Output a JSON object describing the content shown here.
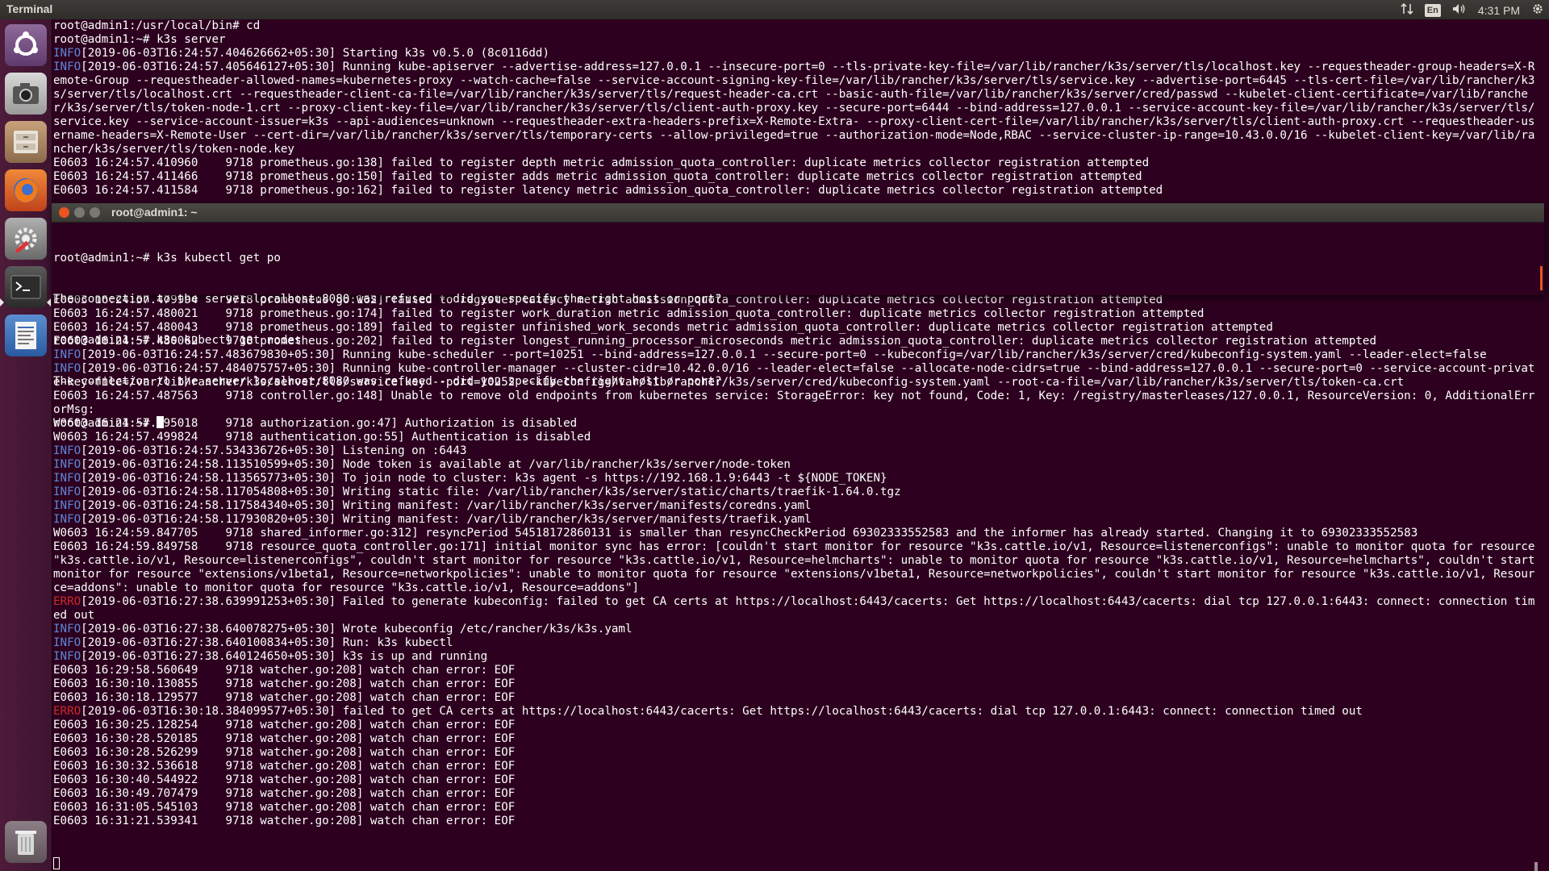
{
  "panel": {
    "app_title": "Terminal",
    "language": "En",
    "time": "4:31 PM"
  },
  "launcher": {
    "items": [
      {
        "name": "Ubuntu Dash",
        "icon": "ubuntu-logo-icon"
      },
      {
        "name": "Camera",
        "icon": "camera-icon"
      },
      {
        "name": "Files",
        "icon": "file-cabinet-icon"
      },
      {
        "name": "Firefox",
        "icon": "firefox-icon"
      },
      {
        "name": "System Settings",
        "icon": "settings-icon"
      },
      {
        "name": "Terminal",
        "icon": "terminal-icon"
      },
      {
        "name": "Text Editor",
        "icon": "text-editor-icon"
      },
      {
        "name": "Trash",
        "icon": "trash-icon"
      }
    ]
  },
  "bg_terminal": {
    "top_lines": [
      {
        "t": "plain",
        "text": "root@admin1:/usr/local/bin# cd"
      },
      {
        "t": "plain",
        "text": "root@admin1:~# k3s server"
      },
      {
        "t": "info",
        "tag": "INFO",
        "text": "[2019-06-03T16:24:57.404626662+05:30] Starting k3s v0.5.0 (8c0116dd)"
      },
      {
        "t": "info",
        "tag": "INFO",
        "text": "[2019-06-03T16:24:57.405646127+05:30] Running kube-apiserver --advertise-address=127.0.0.1 --insecure-port=0 --tls-private-key-file=/var/lib/rancher/k3s/server/tls/localhost.key --requestheader-group-headers=X-Remote-Group --requestheader-allowed-names=kubernetes-proxy --watch-cache=false --service-account-signing-key-file=/var/lib/rancher/k3s/server/tls/service.key --advertise-port=6445 --tls-cert-file=/var/lib/rancher/k3s/server/tls/localhost.crt --requestheader-client-ca-file=/var/lib/rancher/k3s/server/tls/request-header-ca.crt --basic-auth-file=/var/lib/rancher/k3s/server/cred/passwd --kubelet-client-certificate=/var/lib/rancher/k3s/server/tls/token-node-1.crt --proxy-client-key-file=/var/lib/rancher/k3s/server/tls/client-auth-proxy.key --secure-port=6444 --bind-address=127.0.0.1 --service-account-key-file=/var/lib/rancher/k3s/server/tls/service.key --service-account-issuer=k3s --api-audiences=unknown --requestheader-extra-headers-prefix=X-Remote-Extra- --proxy-client-cert-file=/var/lib/rancher/k3s/server/tls/client-auth-proxy.crt --requestheader-username-headers=X-Remote-User --cert-dir=/var/lib/rancher/k3s/server/tls/temporary-certs --allow-privileged=true --authorization-mode=Node,RBAC --service-cluster-ip-range=10.43.0.0/16 --kubelet-client-key=/var/lib/rancher/k3s/server/tls/token-node.key"
      },
      {
        "t": "plain",
        "text": "E0603 16:24:57.410960    9718 prometheus.go:138] failed to register depth metric admission_quota_controller: duplicate metrics collector registration attempted"
      },
      {
        "t": "plain",
        "text": "E0603 16:24:57.411466    9718 prometheus.go:150] failed to register adds metric admission_quota_controller: duplicate metrics collector registration attempted"
      },
      {
        "t": "plain",
        "text": "E0603 16:24:57.411584    9718 prometheus.go:162] failed to register latency metric admission_quota_controller: duplicate metrics collector registration attempted"
      }
    ],
    "bottom_lines": [
      {
        "t": "plain",
        "text": "E0603 16:24:57.479994    9718 prometheus.go:162] failed to register latency metric admission_quota_controller: duplicate metrics collector registration attempted"
      },
      {
        "t": "plain",
        "text": "E0603 16:24:57.480021    9718 prometheus.go:174] failed to register work_duration metric admission_quota_controller: duplicate metrics collector registration attempted"
      },
      {
        "t": "plain",
        "text": "E0603 16:24:57.480043    9718 prometheus.go:189] failed to register unfinished_work_seconds metric admission_quota_controller: duplicate metrics collector registration attempted"
      },
      {
        "t": "plain",
        "text": "E0603 16:24:57.480062    9718 prometheus.go:202] failed to register longest_running_processor_microseconds metric admission_quota_controller: duplicate metrics collector registration attempted"
      },
      {
        "t": "info",
        "tag": "INFO",
        "text": "[2019-06-03T16:24:57.483679830+05:30] Running kube-scheduler --port=10251 --bind-address=127.0.0.1 --secure-port=0 --kubeconfig=/var/lib/rancher/k3s/server/cred/kubeconfig-system.yaml --leader-elect=false"
      },
      {
        "t": "info",
        "tag": "INFO",
        "text": "[2019-06-03T16:24:57.484075757+05:30] Running kube-controller-manager --cluster-cidr=10.42.0.0/16 --leader-elect=false --allocate-node-cidrs=true --bind-address=127.0.0.1 --secure-port=0 --service-account-private-key-file=/var/lib/rancher/k3s/server/tls/service.key --port=10252 --kubeconfig=/var/lib/rancher/k3s/server/cred/kubeconfig-system.yaml --root-ca-file=/var/lib/rancher/k3s/server/tls/token-ca.crt"
      },
      {
        "t": "plain",
        "text": "E0603 16:24:57.487563    9718 controller.go:148] Unable to remove old endpoints from kubernetes service: StorageError: key not found, Code: 1, Key: /registry/masterleases/127.0.0.1, ResourceVersion: 0, AdditionalErrorMsg:"
      },
      {
        "t": "plain",
        "text": "W0603 16:24:57.495018    9718 authorization.go:47] Authorization is disabled"
      },
      {
        "t": "plain",
        "text": "W0603 16:24:57.499824    9718 authentication.go:55] Authentication is disabled"
      },
      {
        "t": "info",
        "tag": "INFO",
        "text": "[2019-06-03T16:24:57.534336726+05:30] Listening on :6443"
      },
      {
        "t": "info",
        "tag": "INFO",
        "text": "[2019-06-03T16:24:58.113510599+05:30] Node token is available at /var/lib/rancher/k3s/server/node-token"
      },
      {
        "t": "info",
        "tag": "INFO",
        "text": "[2019-06-03T16:24:58.113565773+05:30] To join node to cluster: k3s agent -s https://192.168.1.9:6443 -t ${NODE_TOKEN}"
      },
      {
        "t": "info",
        "tag": "INFO",
        "text": "[2019-06-03T16:24:58.117054808+05:30] Writing static file: /var/lib/rancher/k3s/server/static/charts/traefik-1.64.0.tgz"
      },
      {
        "t": "info",
        "tag": "INFO",
        "text": "[2019-06-03T16:24:58.117584340+05:30] Writing manifest: /var/lib/rancher/k3s/server/manifests/coredns.yaml"
      },
      {
        "t": "info",
        "tag": "INFO",
        "text": "[2019-06-03T16:24:58.117930820+05:30] Writing manifest: /var/lib/rancher/k3s/server/manifests/traefik.yaml"
      },
      {
        "t": "plain",
        "text": "W0603 16:24:59.847705    9718 shared_informer.go:312] resyncPeriod 54518172860131 is smaller than resyncCheckPeriod 69302333552583 and the informer has already started. Changing it to 69302333552583"
      },
      {
        "t": "plain",
        "text": "E0603 16:24:59.849758    9718 resource_quota_controller.go:171] initial monitor sync has error: [couldn't start monitor for resource \"k3s.cattle.io/v1, Resource=listenerconfigs\": unable to monitor quota for resource \"k3s.cattle.io/v1, Resource=listenerconfigs\", couldn't start monitor for resource \"k3s.cattle.io/v1, Resource=helmcharts\": unable to monitor quota for resource \"k3s.cattle.io/v1, Resource=helmcharts\", couldn't start monitor for resource \"extensions/v1beta1, Resource=networkpolicies\": unable to monitor quota for resource \"extensions/v1beta1, Resource=networkpolicies\", couldn't start monitor for resource \"k3s.cattle.io/v1, Resource=addons\": unable to monitor quota for resource \"k3s.cattle.io/v1, Resource=addons\"]"
      },
      {
        "t": "erro",
        "tag": "ERRO",
        "text": "[2019-06-03T16:27:38.639991253+05:30] Failed to generate kubeconfig: failed to get CA certs at https://localhost:6443/cacerts: Get https://localhost:6443/cacerts: dial tcp 127.0.0.1:6443: connect: connection timed out"
      },
      {
        "t": "info",
        "tag": "INFO",
        "text": "[2019-06-03T16:27:38.640078275+05:30] Wrote kubeconfig /etc/rancher/k3s/k3s.yaml"
      },
      {
        "t": "info",
        "tag": "INFO",
        "text": "[2019-06-03T16:27:38.640100834+05:30] Run: k3s kubectl"
      },
      {
        "t": "info",
        "tag": "INFO",
        "text": "[2019-06-03T16:27:38.640124650+05:30] k3s is up and running"
      },
      {
        "t": "plain",
        "text": "E0603 16:29:58.560649    9718 watcher.go:208] watch chan error: EOF"
      },
      {
        "t": "plain",
        "text": "E0603 16:30:10.130855    9718 watcher.go:208] watch chan error: EOF"
      },
      {
        "t": "plain",
        "text": "E0603 16:30:18.129577    9718 watcher.go:208] watch chan error: EOF"
      },
      {
        "t": "erro",
        "tag": "ERRO",
        "text": "[2019-06-03T16:30:18.384099577+05:30] failed to get CA certs at https://localhost:6443/cacerts: Get https://localhost:6443/cacerts: dial tcp 127.0.0.1:6443: connect: connection timed out"
      },
      {
        "t": "plain",
        "text": "E0603 16:30:25.128254    9718 watcher.go:208] watch chan error: EOF"
      },
      {
        "t": "plain",
        "text": "E0603 16:30:28.520185    9718 watcher.go:208] watch chan error: EOF"
      },
      {
        "t": "plain",
        "text": "E0603 16:30:28.526299    9718 watcher.go:208] watch chan error: EOF"
      },
      {
        "t": "plain",
        "text": "E0603 16:30:32.536618    9718 watcher.go:208] watch chan error: EOF"
      },
      {
        "t": "plain",
        "text": "E0603 16:30:40.544922    9718 watcher.go:208] watch chan error: EOF"
      },
      {
        "t": "plain",
        "text": "E0603 16:30:49.707479    9718 watcher.go:208] watch chan error: EOF"
      },
      {
        "t": "plain",
        "text": "E0603 16:31:05.545103    9718 watcher.go:208] watch chan error: EOF"
      },
      {
        "t": "plain",
        "text": "E0603 16:31:21.539341    9718 watcher.go:208] watch chan error: EOF"
      }
    ]
  },
  "fg_terminal": {
    "title": "root@admin1: ~",
    "lines": [
      "root@admin1:~# k3s kubectl get po",
      "The connection to the server localhost:8080 was refused - did you specify the right host or port?",
      "root@admin1:~# k3s kubectl get nodes",
      "The connection to the server localhost:8080 was refused - did you specify the right host or port?"
    ],
    "prompt": "root@admin1:~# "
  },
  "colors": {
    "background": "#2c001e",
    "info": "#5f87d7",
    "erro": "#cc2b2b",
    "close": "#e95420"
  }
}
